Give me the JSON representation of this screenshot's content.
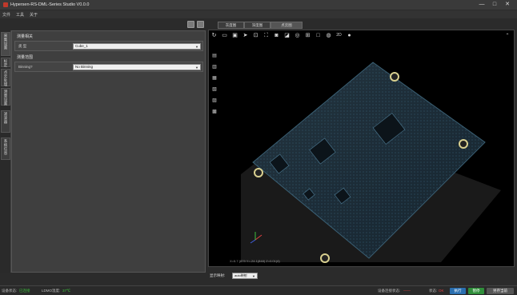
{
  "window": {
    "title": "Hypersen-RS-DML-Series Studio  V0.0.0",
    "minimize": "—",
    "maximize": "□",
    "close": "✕"
  },
  "menu": [
    "文件",
    "工具",
    "关于"
  ],
  "left_rail": [
    {
      "label": "采集设置",
      "active": true
    },
    {
      "label": "标定",
      "active": false
    },
    {
      "label": "点云处理",
      "active": false
    },
    {
      "label": "测量设置",
      "active": false
    },
    {
      "label": "滤波器",
      "active": false
    },
    {
      "label": "系统信息",
      "active": false
    }
  ],
  "settings": {
    "group1_title": "测量相关",
    "group1_field_label": "类    型",
    "group1_field_value": "Cube_1",
    "group2_title": "测量范围",
    "group2_field_label": "Binning?",
    "group2_field_value": "No Binning"
  },
  "view_tabs": [
    {
      "label": "灰度图",
      "active": false
    },
    {
      "label": "深度图",
      "active": false
    },
    {
      "label": "点云图",
      "active": true
    }
  ],
  "viewer": {
    "top_toolbar_icons": [
      "rotate-icon",
      "open-folder-icon",
      "save-icon",
      "send-icon",
      "fit-view-icon",
      "fullscreen-icon",
      "screenshot-icon",
      "color-map-icon",
      "target-icon",
      "frame-icon",
      "box-icon",
      "palette-icon",
      "view-2d-icon"
    ],
    "top_toolbar_text": "2D",
    "side_toolbar_icons": [
      "view-front-icon",
      "view-back-icon",
      "view-left-icon",
      "view-right-icon",
      "view-top-icon",
      "view-bottom-icon"
    ],
    "coord_readout": "X=5.7 (879 Y=-24.1(848) Z=0.01(6)"
  },
  "display": {
    "label": "显示映射:",
    "value": "auto映射"
  },
  "status": {
    "device_label": "设备状态:",
    "device_value": "已连接",
    "temp_label": "LDMO温度:",
    "temp_value": "37℃",
    "measure_label": "设备连接状态:",
    "measure_value": "——",
    "state_label": "状态:",
    "state_value": "OK",
    "btn_run": "执行",
    "btn_stop": "暂停",
    "btn_save": "另存当前"
  },
  "colors": {
    "accent_green": "#3cbf3c",
    "accent_red": "#e04040",
    "run_blue": "#2a6fb0",
    "stop_green": "#2f8f3a"
  }
}
